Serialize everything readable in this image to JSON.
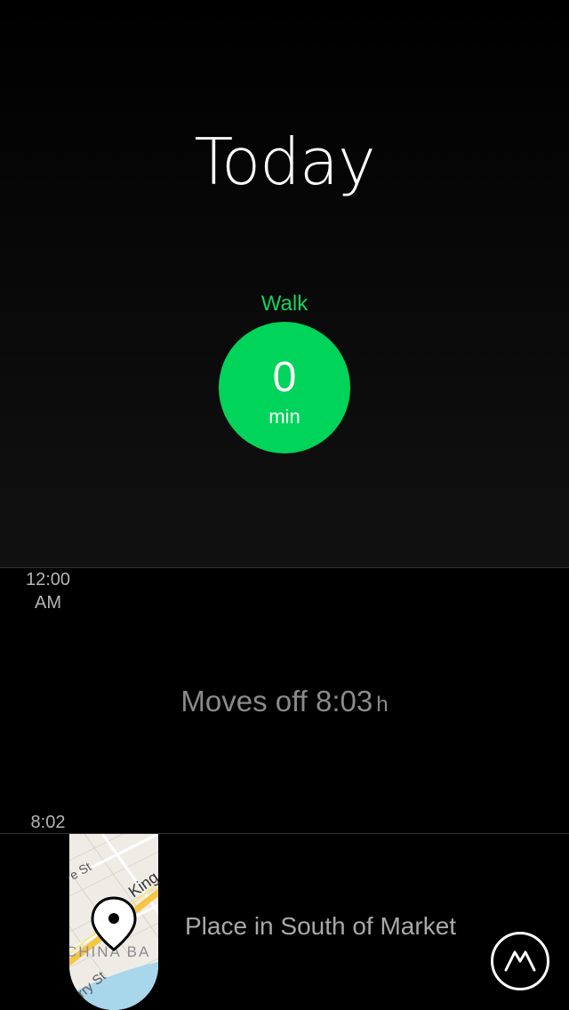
{
  "header": {
    "title": "Today"
  },
  "activity": {
    "label": "Walk",
    "value": "0",
    "unit": "min",
    "color": "#00d45a"
  },
  "timeline": {
    "start_time_line1": "12:00",
    "start_time_line2": "AM",
    "moves_off_label": "Moves off 8:03",
    "moves_off_unit": "h",
    "segment_end_time": "8:02",
    "place_label": "Place in South of Market",
    "map_street_labels": [
      "e St",
      "King",
      "CHINA BA",
      "erry St"
    ]
  },
  "icons": {
    "place_marker": "map-pin-icon",
    "app_button": "moves-logo-icon"
  }
}
